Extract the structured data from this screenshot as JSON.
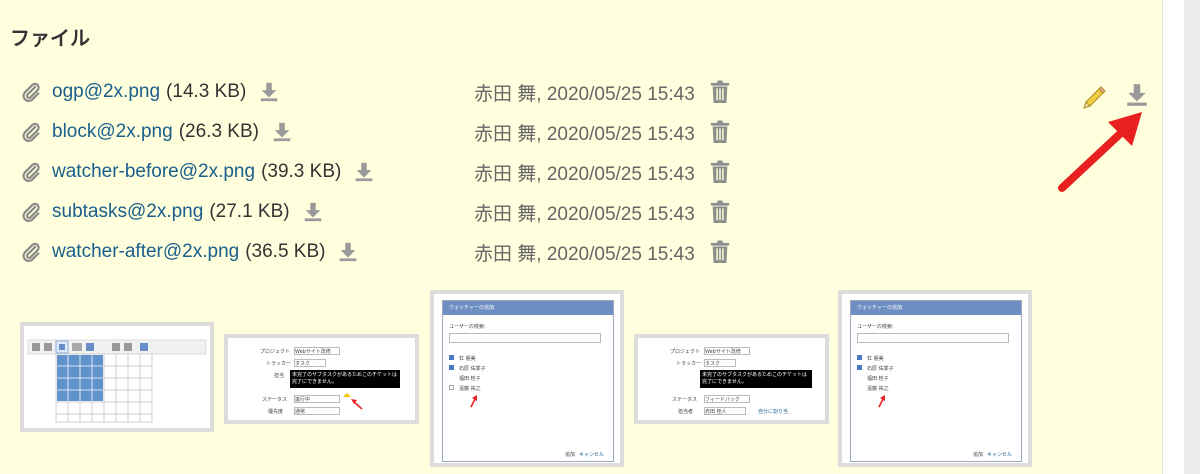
{
  "section": {
    "title": "ファイル"
  },
  "files": [
    {
      "name": "ogp@2x.png",
      "size": "(14.3 KB)",
      "meta": "赤田 舞, 2020/05/25 15:43"
    },
    {
      "name": "block@2x.png",
      "size": "(26.3 KB)",
      "meta": "赤田 舞, 2020/05/25 15:43"
    },
    {
      "name": "watcher-before@2x.png",
      "size": "(39.3 KB)",
      "meta": "赤田 舞, 2020/05/25 15:43"
    },
    {
      "name": "subtasks@2x.png",
      "size": "(27.1 KB)",
      "meta": "赤田 舞, 2020/05/25 15:43"
    },
    {
      "name": "watcher-after@2x.png",
      "size": "(36.5 KB)",
      "meta": "赤田 舞, 2020/05/25 15:43"
    }
  ],
  "icons": {
    "attachment": "paperclip-icon",
    "download": "download-icon",
    "delete": "trash-icon",
    "edit": "pencil-icon",
    "annotation": "red-arrow"
  },
  "thumbs": {
    "t2": {
      "l1": "プロジェクト",
      "v1": "Webサイト改修",
      "l2": "トラッカー",
      "v2": "タスク",
      "l3": "担当",
      "tip": "未完了のサブタスクがあるためこのチケットは完了にできません。",
      "l4": "ステータス",
      "v4": "進行中",
      "l5": "優先度",
      "v5": "通常"
    },
    "t3": {
      "title": "ウォッチャーの追加",
      "search": "ユーザーの検索:",
      "u1": "杠 朋美",
      "u2": "石原 佑季子",
      "u3": "福田 桂子",
      "u4": "遠藤 祐之",
      "add": "追加",
      "cancel": "キャンセル"
    },
    "t4": {
      "l1": "プロジェクト",
      "v1": "Webサイト改修",
      "l2": "トラッカー",
      "v2": "タスク",
      "tip": "未完了のサブタスクがあるためこのチケットは完了にできません。",
      "l4": "ステータス",
      "v4": "フィードバック",
      "l5": "担当者",
      "v5": "赤田 桂人",
      "link": "自分に割り当"
    },
    "t5": {
      "title": "ウォッチャーの追加",
      "search": "ユーザーの検索:",
      "u1": "杠 朋美",
      "u2": "石原 佑季子",
      "u3": "福田 桂子",
      "u4": "遠藤 祐之",
      "add": "追加",
      "cancel": "キャンセル"
    }
  },
  "colors": {
    "link": "#1a5f8c",
    "background": "#ffffdd",
    "arrow": "#e8201f"
  }
}
